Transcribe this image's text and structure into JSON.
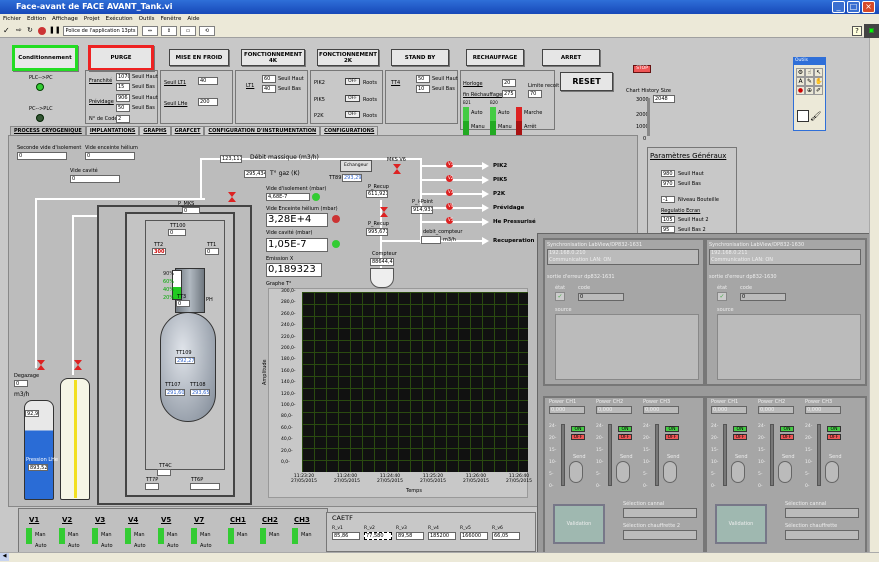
{
  "window": {
    "title": "Face-avant de FACE AVANT_Tank.vi"
  },
  "menu": [
    "Fichier",
    "Edition",
    "Affichage",
    "Projet",
    "Exécution",
    "Outils",
    "Fenêtre",
    "Aide"
  ],
  "toolbar": {
    "font": "Police de l'application 13pts"
  },
  "modes": [
    "Conditionnement",
    "PURGE",
    "MISE EN FROID",
    "FONCTIONNEMENT 4K",
    "FONCTIONNEMENT 2K",
    "STAND BY",
    "RECHAUFFAGE",
    "ARRET"
  ],
  "reset": "RESET",
  "stop": "STOP",
  "history": {
    "label": "Chart History Size",
    "value": "3000",
    "v2": "2048",
    "ticks": [
      "3000",
      "2000",
      "1000",
      "0"
    ]
  },
  "leds": {
    "plc": "PLC-->PC",
    "pc": "PC-->PLC"
  },
  "seuils": {
    "franchis": "Franchité",
    "franchis_v1": "1070",
    "franchis_v2": "15",
    "prevides": "Prévidage",
    "prev_v1": "906",
    "prev_v2": "50",
    "ncode": "N° de Code",
    "ncode_v": "2",
    "haut": "Seuil Haut",
    "bas": "Seuil Bas",
    "lt1": "Seuil LT1",
    "lt1_v": "40",
    "lt2": "Seuil LHe",
    "lt2_v": "200",
    "l1": "LT1",
    "l1_v1": "60",
    "l1_v2": "40",
    "p": [
      "PIK2",
      "PIK5",
      "P2K"
    ],
    "p_btn": "OFF",
    "p_tail": "Roots",
    "tt4": "TT4",
    "tt4_v1": "50",
    "tt4_v2": "10",
    "hor": "Horloge",
    "hor_v": "20",
    "fin": "fin Réchauffage",
    "fin_v": "275",
    "lim": "Limite recoit",
    "lim_v": "70",
    "auto": "Auto",
    "manu": "Manu",
    "marche": "Marche",
    "arret": "Arrêt",
    "b21": "B21",
    "b20": "B20"
  },
  "tabs": [
    "PROCESS CRYOGENIQUE",
    "IMPLANTATIONS",
    "GRAPHS",
    "GRAFCET",
    "CONFIGURATION D'INSTRUMENTATION",
    "CONFIGURATIONS"
  ],
  "process": {
    "vide_label": "Seconde vide d'isolement",
    "vide_v": "0",
    "enc_label": "Vide enceinte hélium",
    "enc_v": "0",
    "cav_label": "Vide cavité",
    "cav_v": "0",
    "debit_label": "Débit massique (m3/h)",
    "debit_v": "123,117",
    "tgaz_label": "T° gaz (K)",
    "tgaz_v": "295,434",
    "vide_iso_label": "Vide d'isolement (mbar)",
    "vide_iso_v": "4,68E-7",
    "vide_he_label": "Vide Enceinte hélium (mbar)",
    "vide_he_v": "3,28E+4",
    "vide_cav_label": "Vide cavité (mbar)",
    "vide_cav_v": "1,05E-7",
    "emission_label": "Emission X",
    "emission_v": "0,189323",
    "graphe": "Graphe T°",
    "ms_label": "MKS V6",
    "tt_label": "TT89",
    "tt_v": "293,29",
    "echang": "Echangeur",
    "precup": "P_Recup",
    "precup_v": "611,921",
    "precup2": "P_Recup",
    "precup2_v": "995,671",
    "compteur": "Compteur",
    "compteur_v": "88644,4",
    "pi": "P_i-Point",
    "pi_v": "914,931",
    "debit_cpt": "debit_compteur",
    "unit": "m3/h",
    "outs": [
      "PIK2",
      "PIK5",
      "P2K",
      "Prévidage",
      "He Pressurisé",
      "Recuperation"
    ],
    "vs": [
      "V1",
      "V2",
      "V3",
      "V4",
      "V5",
      "V7"
    ],
    "pms": "P_MKS",
    "pms_v": "0",
    "tt100": "TT100",
    "tt100_v": "0",
    "tt2": "TT2",
    "tt2_v": "300",
    "tt1": "TT1",
    "tt1_v": "0",
    "tt3": "TT3",
    "tt3_v": "0",
    "ph": "PH",
    "tt109": "TT109",
    "tt109_v": "292,27",
    "tt107": "TT107",
    "tt107_v": "291,60",
    "tt108": "TT108",
    "tt108_v": "293,65",
    "tt4c": "TT4C",
    "tt7p": "TT7P",
    "tt6p": "TT6P",
    "oh": "OH",
    "lbl_m3": "m3/h",
    "deg": "Degazage",
    "deg_v": "0",
    "p1": "92,9",
    "plhe": "Pression LHe",
    "plhe_v": "893,52",
    "pct": [
      "90%",
      "60%",
      "40%",
      "20%"
    ]
  },
  "chart": {
    "xlabel": "Temps",
    "ylabel": "Amplitude",
    "yticks": [
      "300,0-",
      "280,0-",
      "260,0-",
      "240,0-",
      "220,0-",
      "200,0-",
      "180,0-",
      "160,0-",
      "140,0-",
      "120,0-",
      "100,0-",
      "80,0-",
      "60,0-",
      "40,0-",
      "20,0-",
      "0,0-"
    ],
    "xticks": [
      "11:23:20\n27/05/2015",
      "11:24:00\n27/05/2015",
      "11:24:40\n27/05/2015",
      "11:25:20\n27/05/2015",
      "11:26:00\n27/05/2015",
      "11:26:40\n27/05/2015"
    ]
  },
  "params": {
    "title": "Paramètres Généraux",
    "v1": "980",
    "l1": "Seuil Haut",
    "v2": "970",
    "l2": "Seuil Bas",
    "v3": "-1",
    "l3": "Niveau Bouteille",
    "reg": "Regulatio Ecran",
    "v4": "105",
    "l4": "Seuil Haut 2",
    "v5": "95",
    "l5": "Seuil Bas 2"
  },
  "sync": [
    {
      "title": "Synchronisation LabView/DP832-1631",
      "ip": "192.168.0.210",
      "comm": "Communication LAN: ON",
      "err": "sortie d'erreur dp832-1631",
      "etat": "état",
      "code": "code",
      "code_v": "0",
      "source": "source",
      "ch": [
        "Power CH1",
        "Power CH2",
        "Power CH3"
      ],
      "ch_v": [
        "0,000",
        "0,000",
        "0,000"
      ],
      "valid": "Validation",
      "sel1": "Sélection cannal",
      "sel2": "Sélection chauffrette 2"
    },
    {
      "title": "Synchronisation LabView/DP832-1630",
      "ip": "192.168.0.211",
      "comm": "Communication LAN: ON",
      "err": "sortie d'erreur dp832-1630",
      "etat": "état",
      "code": "code",
      "code_v": "0",
      "source": "source",
      "ch": [
        "Power CH1",
        "Power CH2",
        "Power CH3"
      ],
      "ch_v": [
        "0,000",
        "0,000",
        "0,000"
      ],
      "valid": "Validation",
      "sel1": "Sélection cannal",
      "sel2": "Sélection chauffrette"
    }
  ],
  "scale": [
    "24-",
    "20-",
    "15-",
    "10-",
    "5-",
    "0-"
  ],
  "ctrl": {
    "on": "ON",
    "off": "OFF",
    "send": "Send"
  },
  "bottom": {
    "vs": [
      "V1",
      "V2",
      "V3",
      "V4",
      "V5",
      "V7"
    ],
    "chs": [
      "CH1",
      "CH2",
      "CH3"
    ],
    "man": "Man",
    "auto": "Auto",
    "caeff": "CAETF",
    "vals": [
      "85,86",
      "77,580",
      "89,58",
      "185200",
      "166000",
      "66,05"
    ],
    "vlabels": [
      "R_v1",
      "R_v2",
      "R_v3",
      "R_v4",
      "R_v5",
      "R_v6"
    ]
  },
  "palette": {
    "title": "Outils"
  }
}
